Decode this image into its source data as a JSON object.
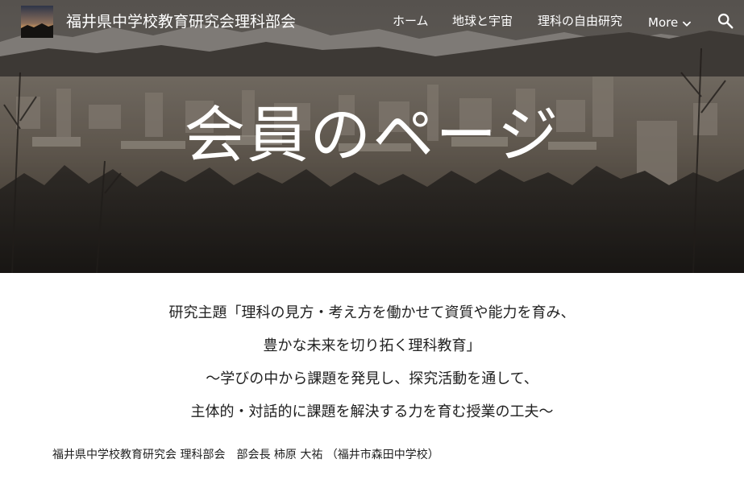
{
  "header": {
    "site_title": "福井県中学校教育研究会理科部会",
    "nav": [
      {
        "label": "ホーム"
      },
      {
        "label": "地球と宇宙"
      },
      {
        "label": "理科の自由研究"
      },
      {
        "label": "More"
      }
    ],
    "icons": {
      "logo": "site-logo-image",
      "more": "chevron-down-icon",
      "search": "search-icon"
    }
  },
  "hero": {
    "title": "会員のページ"
  },
  "main": {
    "theme_lines": [
      "研究主題「理科の見方・考え方を働かせて資質や能力を育み、",
      "豊かな未来を切り拓く理科教育」",
      "〜学びの中から課題を発見し、探究活動を通して、",
      "主体的・対話的に課題を解決する力を育む授業の工夫〜"
    ],
    "president_line": "福井県中学校教育研究会 理科部会　部会長 柿原 大祐 （福井市森田中学校）"
  },
  "colors": {
    "text": "#212121",
    "header_text": "#ffffff",
    "background": "#ffffff"
  }
}
